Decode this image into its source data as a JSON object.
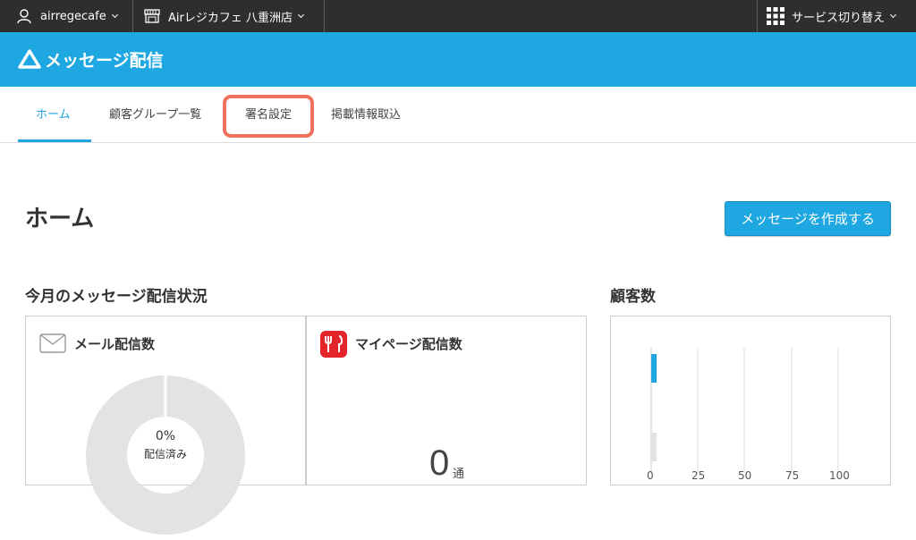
{
  "topbar": {
    "account": "airregecafe",
    "store": "Airレジカフェ 八重洲店",
    "services": "サービス切り替え"
  },
  "app": {
    "title": "メッセージ配信"
  },
  "tabs": [
    {
      "label": "ホーム",
      "active": true
    },
    {
      "label": "顧客グループ一覧",
      "active": false
    },
    {
      "label": "署名設定",
      "active": false,
      "highlighted": true
    },
    {
      "label": "掲載情報取込",
      "active": false
    }
  ],
  "page": {
    "title": "ホーム",
    "create_button": "メッセージを作成する"
  },
  "status_section": {
    "title": "今月のメッセージ配信状況",
    "mail": {
      "title": "メール配信数",
      "percent": "0%",
      "caption": "配信済み",
      "delivered_fraction": 0
    },
    "mypage": {
      "title": "マイページ配信数",
      "count": "0",
      "unit": "通"
    }
  },
  "customers": {
    "title": "顧客数",
    "ticks": [
      "0",
      "25",
      "50",
      "75",
      "100"
    ]
  },
  "colors": {
    "accent": "#1ea7e1",
    "highlight": "#f0715d",
    "mypage_icon": "#e4242b"
  }
}
